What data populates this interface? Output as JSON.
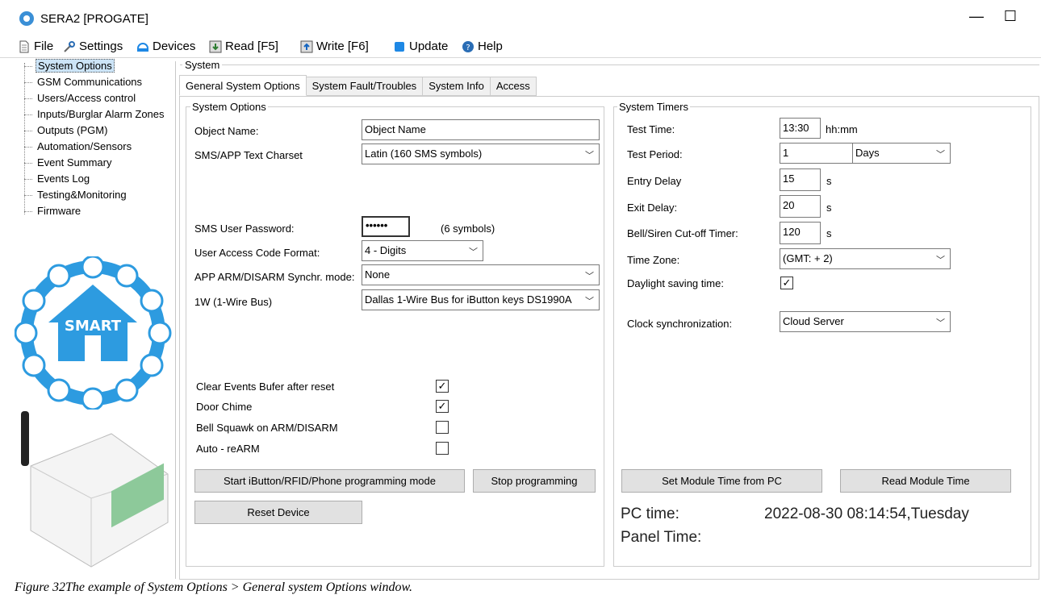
{
  "window": {
    "title": "SERA2 [PROGATE]",
    "minimize_glyph": "—",
    "maximize_glyph": "☐"
  },
  "menu": [
    {
      "label": "File",
      "icon": "file-icon"
    },
    {
      "label": "Settings",
      "icon": "settings-icon"
    },
    {
      "label": "Devices",
      "icon": "devices-icon"
    },
    {
      "label": "Read [F5]",
      "icon": "read-icon"
    },
    {
      "label": "Write [F6]",
      "icon": "write-icon"
    },
    {
      "label": "Update",
      "icon": "update-icon"
    },
    {
      "label": "Help",
      "icon": "help-icon"
    }
  ],
  "tree": [
    "System Options",
    "GSM Communications",
    "Users/Access control",
    "Inputs/Burglar Alarm Zones",
    "Outputs (PGM)",
    "Automation/Sensors",
    "Event Summary",
    "Events Log",
    "Testing&Monitoring",
    "Firmware"
  ],
  "section_title": "System",
  "tabs": [
    "General System Options",
    "System Fault/Troubles",
    "System Info",
    "Access"
  ],
  "system_options": {
    "legend": "System Options",
    "object_name_label": "Object Name:",
    "object_name_value": "Object Name",
    "charset_label": "SMS/APP Text Charset",
    "charset_value": "Latin (160 SMS symbols)",
    "password_label": "SMS User Password:",
    "password_value": "••••••",
    "password_hint": "(6 symbols)",
    "code_format_label": "User Access Code Format:",
    "code_format_value": "4 - Digits",
    "sync_label": "APP ARM/DISARM Synchr. mode:",
    "sync_value": "None",
    "wire_label": "1W (1-Wire Bus)",
    "wire_value": "Dallas 1-Wire Bus for   iButton keys DS1990A",
    "checks": [
      {
        "label": "Clear Events Bufer after reset",
        "checked": true
      },
      {
        "label": "Door Chime",
        "checked": true
      },
      {
        "label": "Bell Squawk on ARM/DISARM",
        "checked": false
      },
      {
        "label": "Auto - reARM",
        "checked": false
      }
    ],
    "start_prog_btn": "Start iButton/RFID/Phone  programming mode",
    "stop_prog_btn": "Stop  programming",
    "reset_btn": "Reset Device"
  },
  "system_timers": {
    "legend": "System Timers",
    "test_time_label": "Test Time:",
    "test_time_value": "13:30",
    "test_time_unit": "hh:mm",
    "test_period_label": "Test Period:",
    "test_period_value": "1",
    "test_period_unit": "Days",
    "entry_label": "Entry Delay",
    "entry_value": "15",
    "exit_label": "Exit Delay:",
    "exit_value": "20",
    "bell_label": "Bell/Siren Cut-off Timer:",
    "bell_value": "120",
    "seconds_unit": "s",
    "tz_label": "Time Zone:",
    "tz_value": "(GMT: +  2)",
    "dst_label": "Daylight saving time:",
    "dst_checked": true,
    "clock_label": "Clock synchronization:",
    "clock_value": "Cloud Server",
    "set_time_btn": "Set Module Time from PC",
    "read_time_btn": "Read Module Time",
    "pc_time_label": "PC time:",
    "pc_time_value": "2022-08-30 08:14:54,Tuesday",
    "panel_time_label": "Panel Time:"
  },
  "smart_logo": {
    "text": "SMART"
  },
  "caption": "Figure 32The example of System Options > General system Options window."
}
